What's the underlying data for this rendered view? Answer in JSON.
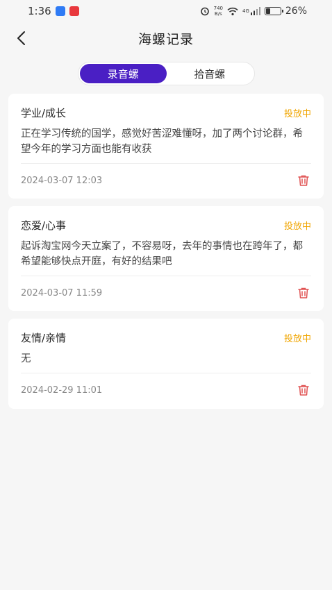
{
  "status_bar": {
    "time": "1:36",
    "net_speed_value": "740",
    "net_speed_unit": "B/s",
    "network_type": "4G",
    "battery": "26%"
  },
  "header": {
    "title": "海螺记录"
  },
  "tabs": [
    {
      "label": "录音螺",
      "active": true
    },
    {
      "label": "拾音螺",
      "active": false
    }
  ],
  "records": [
    {
      "category": "学业/成长",
      "status": "投放中",
      "content": "正在学习传统的国学，感觉好苦涩难懂呀，加了两个讨论群，希望今年的学习方面也能有收获",
      "date": "2024-03-07 12:03"
    },
    {
      "category": "恋爱/心事",
      "status": "投放中",
      "content": "起诉淘宝网今天立案了，不容易呀，去年的事情也在跨年了，都希望能够快点开庭，有好的结果吧",
      "date": "2024-03-07 11:59"
    },
    {
      "category": "友情/亲情",
      "status": "投放中",
      "content": "无",
      "date": "2024-02-29 11:01"
    }
  ],
  "colors": {
    "accent": "#4a1fc4",
    "status": "#f0a500",
    "delete": "#e05050"
  }
}
